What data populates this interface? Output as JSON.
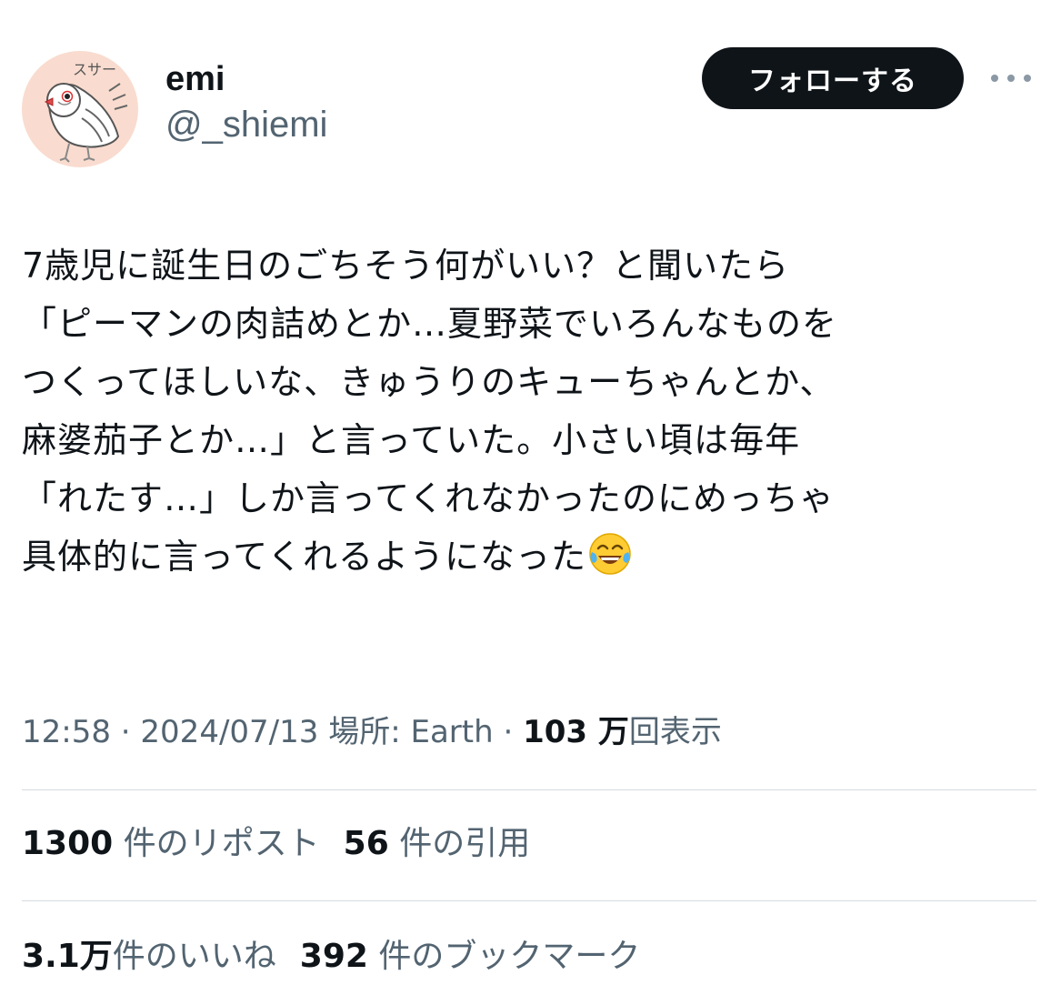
{
  "user": {
    "display_name": "emi",
    "handle": "@_shiemi",
    "avatar_text": "スサー",
    "follow_label": "フォローする"
  },
  "tweet": {
    "lines": [
      "7歳児に誕生日のごちそう何がいい？と聞いたら",
      "「ピーマンの肉詰めとか…夏野菜でいろんなものを",
      "つくってほしいな、きゅうりのキューちゃんとか、",
      "麻婆茄子とか…」と言っていた。小さい頃は毎年",
      "「れたす…」しか言ってくれなかったのにめっちゃ",
      "具体的に言ってくれるようになった"
    ],
    "emoji": "face-with-tears-of-joy"
  },
  "meta": {
    "time": "12:58",
    "sep1": " · ",
    "date": "2024/07/13",
    "location": " 場所: Earth",
    "sep2": " · ",
    "views_count": "103 万",
    "views_label": "回表示"
  },
  "stats": {
    "reposts_count": "1300",
    "reposts_label": " 件のリポスト",
    "quotes_count": "56",
    "quotes_label": " 件の引用",
    "likes_count": "3.1万",
    "likes_label": "件のいいね",
    "bookmarks_count": "392",
    "bookmarks_label": " 件のブックマーク"
  },
  "colors": {
    "text": "#0f1419",
    "secondary": "#536471",
    "divider": "#d6dbdf",
    "avatar_bg": "#f9dccf"
  }
}
